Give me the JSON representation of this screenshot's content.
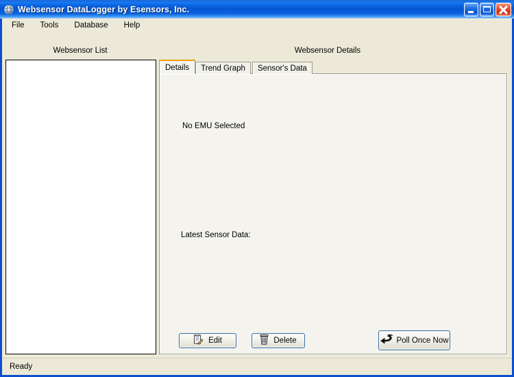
{
  "window": {
    "title": "Websensor DataLogger by Esensors, Inc.",
    "app_icon": "globe-icon",
    "controls": {
      "minimize_label": "Minimize",
      "maximize_label": "Maximize",
      "close_label": "Close"
    },
    "frame_color": "#0b4fcf",
    "titlebar_color": "#0456d0",
    "face_color": "#ece9d8"
  },
  "menu": {
    "items": [
      {
        "label": "File"
      },
      {
        "label": "Tools"
      },
      {
        "label": "Database"
      },
      {
        "label": "Help"
      }
    ]
  },
  "left_pane": {
    "heading": "Websensor List",
    "items": []
  },
  "right_pane": {
    "heading": "Websensor Details",
    "tabs": [
      {
        "label": "Details",
        "active": true
      },
      {
        "label": "Trend Graph",
        "active": false
      },
      {
        "label": "Sensor's Data",
        "active": false
      }
    ],
    "active_tab_accent": "#f0a000",
    "details": {
      "no_selection_text": "No EMU Selected",
      "latest_sensor_data_label": "Latest Sensor Data:",
      "latest_sensor_data_value": "",
      "buttons": [
        {
          "label": "Edit",
          "icon": "edit-pencil-icon"
        },
        {
          "label": "Delete",
          "icon": "trash-can-icon"
        },
        {
          "label": "Poll Once Now",
          "icon": "poll-arrow-icon"
        }
      ]
    }
  },
  "statusbar": {
    "text": "Ready"
  }
}
